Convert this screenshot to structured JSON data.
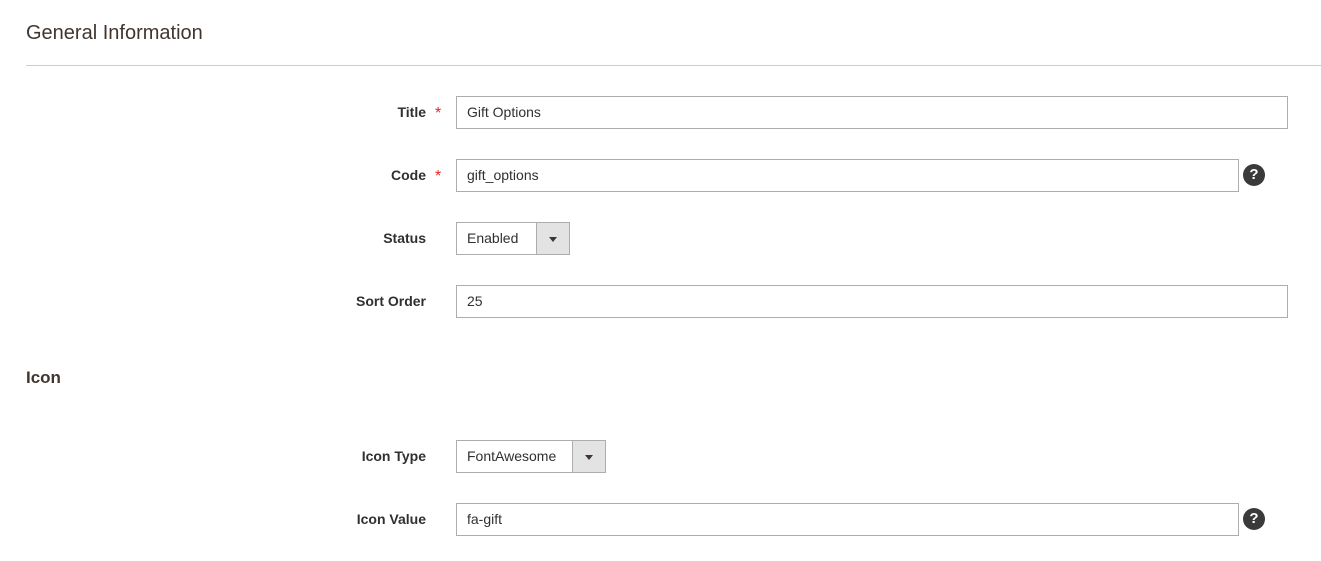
{
  "general": {
    "title": "General Information",
    "fields": {
      "title": {
        "label": "Title",
        "required_mark": "*",
        "value": "Gift Options"
      },
      "code": {
        "label": "Code",
        "required_mark": "*",
        "value": "gift_options",
        "help": "?"
      },
      "status": {
        "label": "Status",
        "value": "Enabled"
      },
      "sort_order": {
        "label": "Sort Order",
        "value": "25"
      }
    }
  },
  "icon": {
    "title": "Icon",
    "fields": {
      "icon_type": {
        "label": "Icon Type",
        "value": "FontAwesome"
      },
      "icon_value": {
        "label": "Icon Value",
        "value": "fa-gift",
        "help": "?"
      }
    }
  },
  "colors": {
    "required": "#e22626",
    "border": "#adadad",
    "heading": "#41362f"
  },
  "icons": {
    "help": "question-circle-icon",
    "dropdown": "chevron-down-icon"
  }
}
